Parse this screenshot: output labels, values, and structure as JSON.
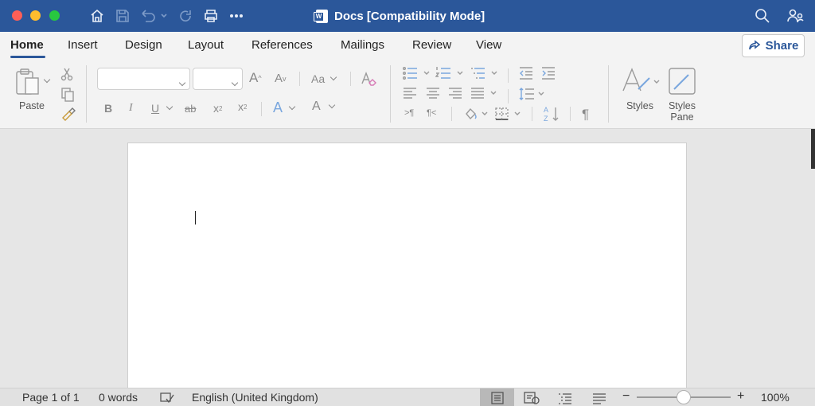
{
  "window": {
    "title": "Docs [Compatibility Mode]"
  },
  "titlebar_icons": [
    "home-icon",
    "save-icon",
    "undo-icon",
    "redo-icon",
    "print-icon",
    "more-icon",
    "search-icon",
    "collaborate-icon"
  ],
  "tabs": [
    {
      "label": "Home",
      "active": true
    },
    {
      "label": "Insert"
    },
    {
      "label": "Design"
    },
    {
      "label": "Layout"
    },
    {
      "label": "References"
    },
    {
      "label": "Mailings"
    },
    {
      "label": "Review"
    },
    {
      "label": "View"
    }
  ],
  "share": {
    "label": "Share"
  },
  "ribbon": {
    "paste_label": "Paste",
    "font_name": "",
    "font_size": "",
    "grow_font": "A",
    "shrink_font": "A",
    "change_case": "Aa",
    "bold": "B",
    "italic": "I",
    "underline": "U",
    "strikethrough": "ab",
    "subscript": "x",
    "superscript": "x",
    "text_effects": "A",
    "font_color": "A",
    "show_marks": "¶",
    "ltr": ">¶",
    "rtl": "¶<",
    "sort": "AZ",
    "styles_label": "Styles",
    "styles_pane_label_1": "Styles",
    "styles_pane_label_2": "Pane"
  },
  "statusbar": {
    "page": "Page 1 of 1",
    "words": "0 words",
    "language": "English (United Kingdom)",
    "zoom": "100%",
    "zoom_fraction": 0.5
  },
  "colors": {
    "titlebar": "#2b579a",
    "accent": "#2b579a"
  }
}
